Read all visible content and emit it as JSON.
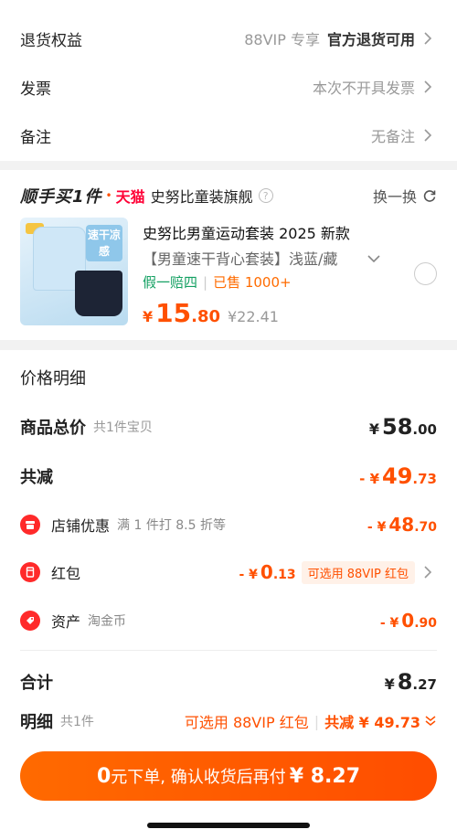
{
  "top_rows": {
    "return": {
      "label": "退货权益",
      "note": "88VIP 专享",
      "value": "官方退货可用"
    },
    "invoice": {
      "label": "发票",
      "value": "本次不开具发票"
    },
    "remark": {
      "label": "备注",
      "value": "无备注"
    }
  },
  "shop": {
    "brand_text": "顺手买1件",
    "dot": "•",
    "platform": "天猫",
    "name": "史努比童装旗舰",
    "help_icon": "?",
    "swap_label": "换一换"
  },
  "product": {
    "title": "史努比男童运动套装 2025 新款",
    "spec": "【男童速干背心套装】浅蓝/藏",
    "tag_guarantee": "假一赔四",
    "tag_sep": "|",
    "tag_sold": "已售 1000+",
    "price_symbol": "¥",
    "price_int": "15",
    "price_dec": ".80",
    "orig_price": "¥22.41",
    "thumb_text": "速干凉感"
  },
  "price": {
    "section_title": "价格明细",
    "total": {
      "label": "商品总价",
      "note": "共1件宝贝",
      "symbol": "¥",
      "int": "58",
      "dec": ".00"
    },
    "discount": {
      "label": "共减",
      "prefix": "- ¥",
      "int": "49",
      "dec": ".73"
    },
    "shop_discount": {
      "label": "店铺优惠",
      "note": "满 1 件打 8.5 折等",
      "prefix": "- ¥",
      "int": "48",
      "dec": ".70"
    },
    "red_packet": {
      "label": "红包",
      "prefix": "- ¥",
      "int": "0",
      "dec": ".13",
      "pill": "可选用 88VIP 红包"
    },
    "asset": {
      "label": "资产",
      "note": "淘金币",
      "prefix": "- ¥",
      "int": "0",
      "dec": ".90"
    },
    "sum": {
      "label": "合计",
      "symbol": "¥",
      "int": "8",
      "dec": ".27"
    },
    "detail": {
      "label": "明细",
      "note": "共1件",
      "packet": "可选用 88VIP 红包",
      "sep": "|",
      "total_reduce": "共减 ¥ 49.73"
    }
  },
  "cta": {
    "zero": "0",
    "text": "元下单, 确认收货后再付",
    "amount": "¥ 8.27"
  },
  "colors": {
    "accent": "#ff5000",
    "green": "#13a062",
    "icon_red": "#ff2a2a"
  }
}
